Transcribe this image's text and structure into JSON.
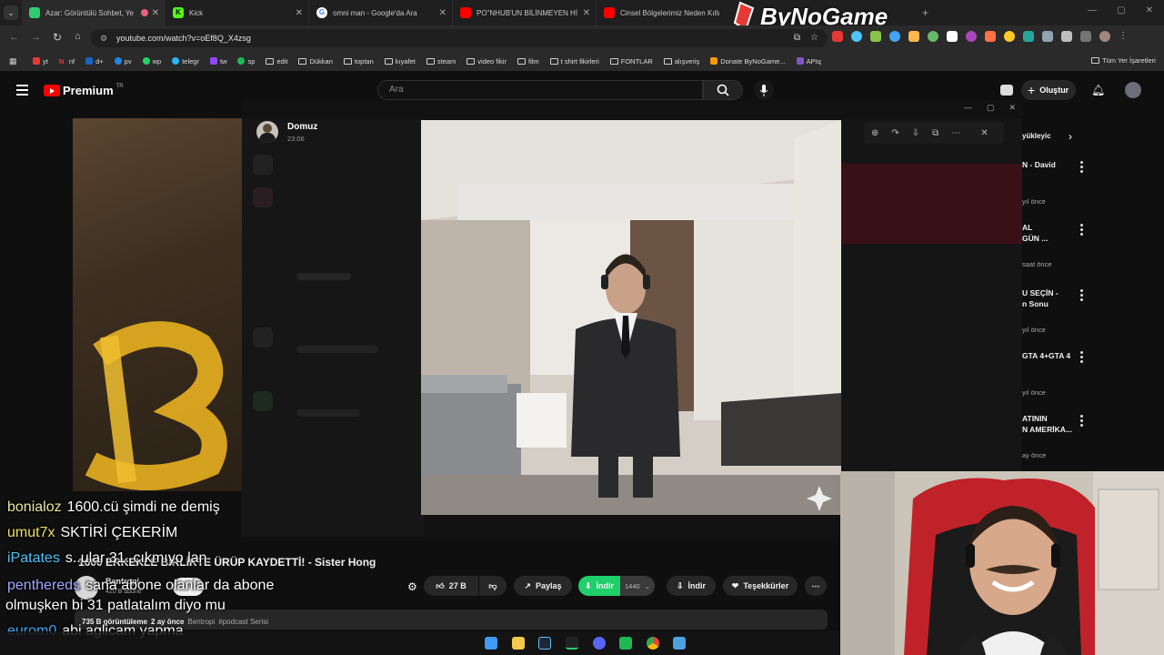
{
  "browser": {
    "tabs": [
      {
        "label": "Azar: Görüntülü Sohbet, Ye",
        "color": "#2ecc71"
      },
      {
        "label": "Kick",
        "color": "#53fc18"
      },
      {
        "label": "omni man - Google'da Ara",
        "color": "#4285f4"
      },
      {
        "label": "PO\"NHUB'UN BİLİNMEYEN Hİ",
        "color": "#ff0000"
      },
      {
        "label": "Cinsel Bölgelerimiz Neden Kıllı",
        "color": "#ff0000"
      }
    ],
    "url": "youtube.com/watch?v=oEf8Q_X4zsg",
    "bookmarks": [
      "yt",
      "nf",
      "d+",
      "pv",
      "wp",
      "telegr",
      "tw",
      "sp",
      "edit",
      "Dükkan",
      "toptan",
      "kıyafet",
      "steam",
      "video fikir",
      "film",
      "t shirt fikirleri",
      "FONTLAR",
      "alışveriş",
      "Donate ByNoGame...",
      "APIq",
      "Tüm Yer İşaretleri"
    ]
  },
  "watermark": "ByNoGame",
  "youtube": {
    "logo": "Premium",
    "region": "TR",
    "search_placeholder": "Ara",
    "create_label": "Oluştur"
  },
  "viewer": {
    "sender": "Domuz",
    "time": "23:06"
  },
  "sidebar": {
    "header": "yükleyic",
    "items": [
      {
        "title": "N - David",
        "meta": "yıl önce"
      },
      {
        "title": "AL\nGÜN ...",
        "meta": "saat önce"
      },
      {
        "title": "U SEÇİN -\nn Sonu",
        "meta": "yıl önce"
      },
      {
        "title": "GTA 4+GTA 4",
        "meta": "yıl önce"
      },
      {
        "title": "ATININ\nN AMERİKA...",
        "meta": "ay önce"
      }
    ]
  },
  "video": {
    "title": "1600 ERKEKLE BİRLİKTE ÜRÜP KAYDETTİ! - Sister Hong",
    "channel": "Bentropi",
    "subs": "420 B abone",
    "likes": "27 B",
    "share": "Paylaş",
    "download_green": "İndir",
    "quality": "1440",
    "download": "İndir",
    "thanks": "Teşekkürler",
    "views": "735 B görüntüleme",
    "age": "2 ay önce",
    "channel_ref": "Bentropi",
    "tag": "#podcast Serisi"
  },
  "chat": [
    {
      "user": "bonialoz",
      "msg": "1600.cü şimdi ne demiş",
      "color": "#e8e8a0"
    },
    {
      "user": "umut7x",
      "msg": "SKTİRİ ÇEKERİM",
      "color": "#f0e060"
    },
    {
      "user": "iPatates",
      "msg": "s..ular 31. çıkmıyo lan",
      "color": "#4fc3f7"
    },
    {
      "user": "penthereds",
      "msg": "sana abone olanlar da abone",
      "color": "#9fa8ff"
    },
    {
      "user": "",
      "msg": "olmuşken bi 31 patlatalım diyo mu",
      "color": "#ffffff"
    },
    {
      "user": "eurom0",
      "msg": "abi aglicam yapma",
      "color": "#42a5f5"
    }
  ]
}
